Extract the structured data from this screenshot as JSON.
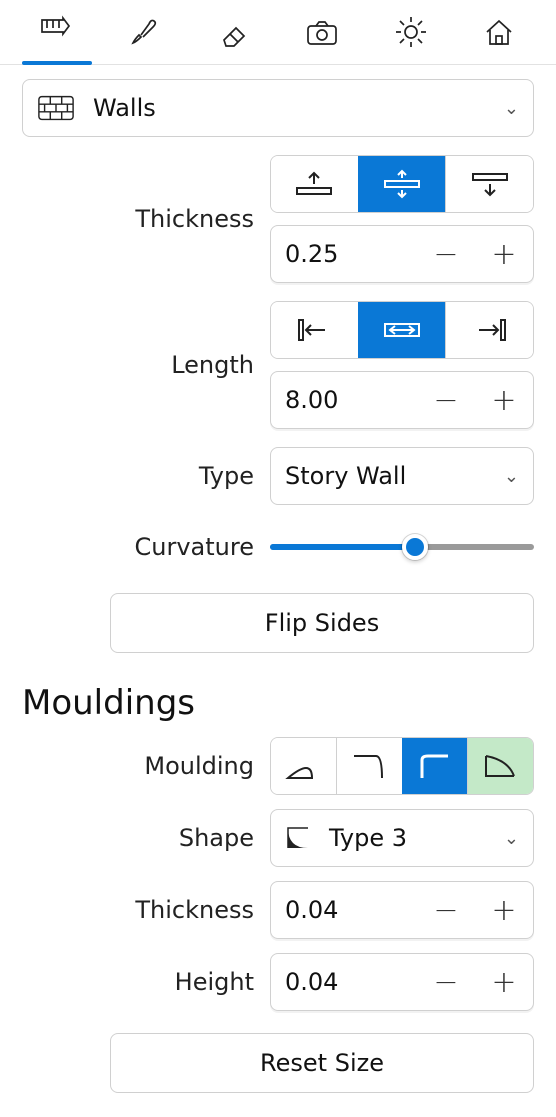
{
  "colors": {
    "accent": "#0a78d6",
    "highlight": "#c4e9c8"
  },
  "tabs": [
    "measure",
    "brush",
    "eraser",
    "camera",
    "sun",
    "house"
  ],
  "selected_tab": 0,
  "category": {
    "icon": "brick-wall-icon",
    "label": "Walls"
  },
  "thickness": {
    "label": "Thickness",
    "value": "0.25",
    "mode_options": [
      "expand-up",
      "expand-both",
      "expand-down"
    ],
    "mode_selected": 1
  },
  "length": {
    "label": "Length",
    "value": "8.00",
    "mode_options": [
      "align-left",
      "align-both",
      "align-right"
    ],
    "mode_selected": 1
  },
  "type": {
    "label": "Type",
    "value": "Story Wall"
  },
  "curvature": {
    "label": "Curvature",
    "percent": 55
  },
  "flip_button": "Flip Sides",
  "mouldings": {
    "heading": "Mouldings",
    "moulding": {
      "label": "Moulding",
      "options": [
        "curve-baseboard",
        "cornice-top",
        "radius-corner",
        "chamfer-corner"
      ],
      "selected": 2,
      "highlighted": 3
    },
    "shape": {
      "label": "Shape",
      "icon": "shape-type3-icon",
      "value": "Type 3"
    },
    "thickness": {
      "label": "Thickness",
      "value": "0.04"
    },
    "height": {
      "label": "Height",
      "value": "0.04"
    },
    "reset_button": "Reset Size"
  }
}
